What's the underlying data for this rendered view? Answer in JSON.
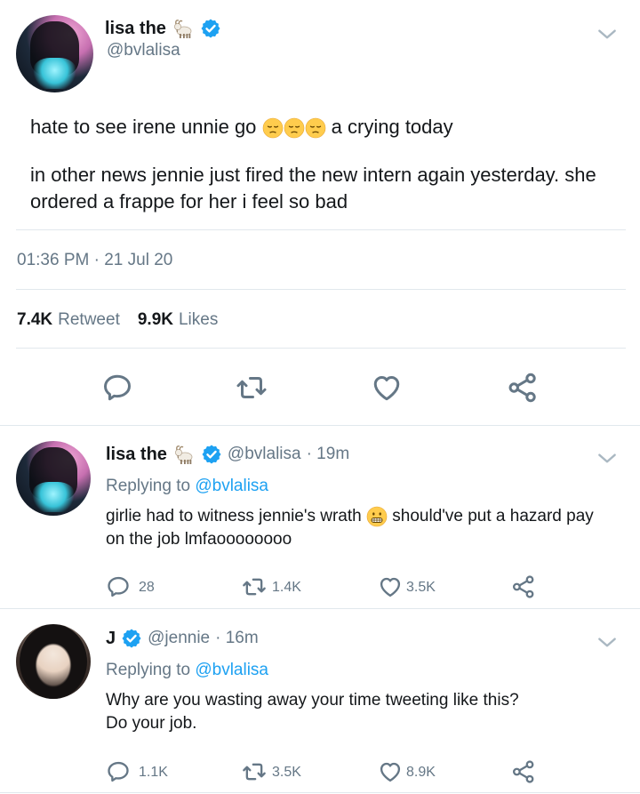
{
  "main_tweet": {
    "display_name": "lisa the",
    "name_emoji": "goat-emoji",
    "handle": "@bvlalisa",
    "verified": true,
    "text_line1_a": "hate to see irene unnie go",
    "text_line1_b": "a crying today",
    "text_emoji": "pensive-face-emoji",
    "text_para2": "in other news jennie just fired the new intern again yesterday. she ordered a frappe for her i feel so bad",
    "timestamp": "01:36 PM · 21 Jul 20",
    "retweets": "7.4K",
    "retweets_label": "Retweet",
    "likes": "9.9K",
    "likes_label": "Likes",
    "actions": [
      "reply-icon",
      "retweet-icon",
      "like-icon",
      "share-icon"
    ]
  },
  "replies": [
    {
      "display_name": "lisa the",
      "name_emoji": "goat-emoji",
      "handle": "@bvlalisa",
      "time": "· 19m",
      "replying_prefix": "Replying to",
      "replying_to": "@bvlalisa",
      "text_a": "girlie had to witness jennie's wrath",
      "text_emoji": "grimacing-face-emoji",
      "text_b": "should've put a hazard pay on the job lmfaoooooooo",
      "reply_count": "28",
      "retweet_count": "1.4K",
      "like_count": "3.5K"
    },
    {
      "display_name": "J",
      "handle": "@jennie",
      "time": "· 16m",
      "replying_prefix": "Replying to",
      "replying_to": "@bvlalisa",
      "text": "Why are you wasting away your time tweeting like this? Do your job.",
      "reply_count": "1.1K",
      "retweet_count": "3.5K",
      "like_count": "8.9K"
    }
  ],
  "colors": {
    "link": "#1da1f2",
    "muted": "#657786",
    "text": "#14171a",
    "verified": "#1da1f2",
    "divider": "#e1e8ed"
  }
}
